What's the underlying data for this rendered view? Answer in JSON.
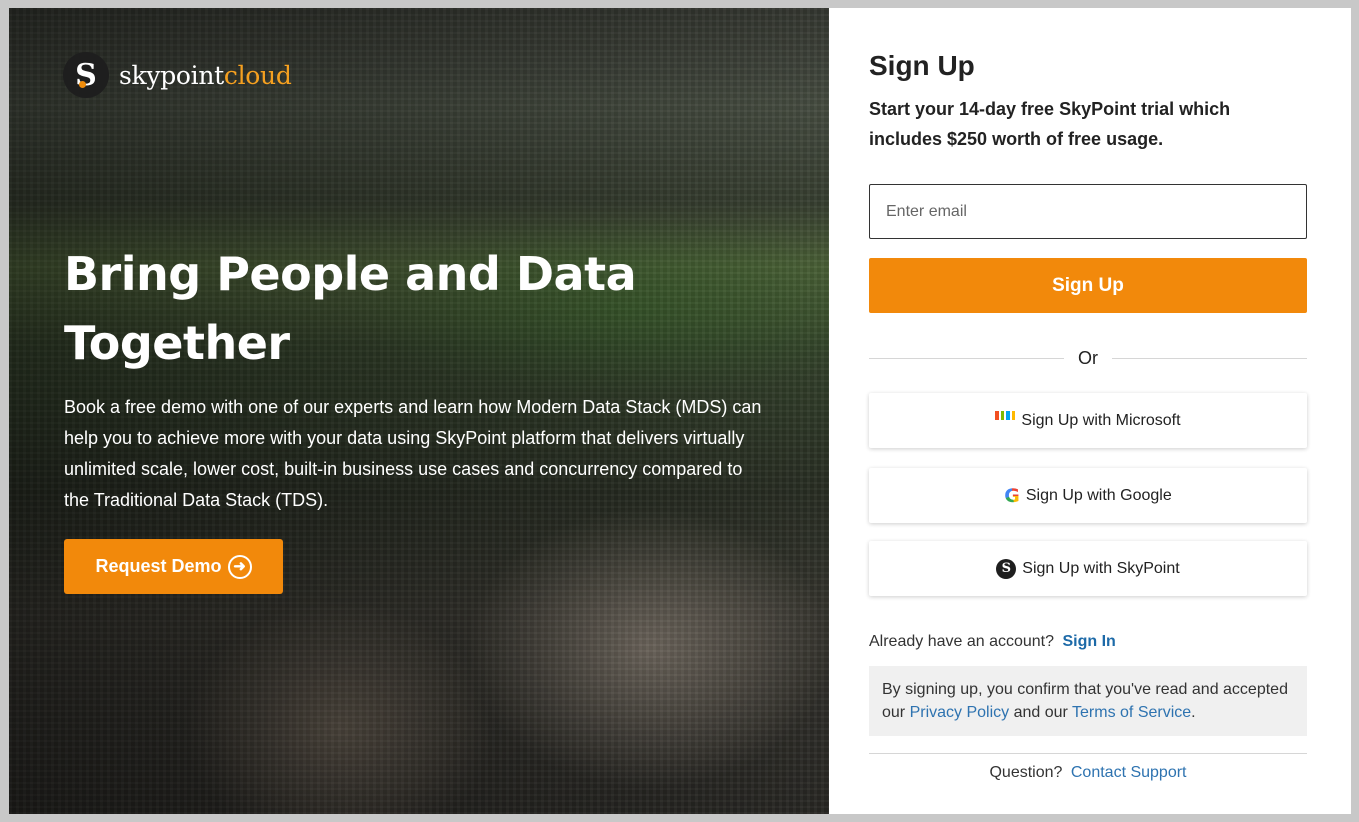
{
  "brand": {
    "logo_mark": "S",
    "name_part1": "skypoint",
    "name_part2": "cloud"
  },
  "hero": {
    "title": "Bring People and Data Together",
    "description": "Book a free demo with one of our experts and learn how Modern Data Stack (MDS) can help you to achieve more with your data using SkyPoint platform that delivers virtually unlimited scale, lower cost, built-in business use cases and concurrency compared to the Traditional Data Stack (TDS).",
    "demo_button": "Request Demo",
    "demo_icon": "arrow-right-circle-icon"
  },
  "signup": {
    "title": "Sign Up",
    "subtitle": "Start your 14-day free SkyPoint trial which includes $250 worth of free usage.",
    "email_placeholder": "Enter email",
    "email_value": "",
    "submit_label": "Sign Up",
    "divider_text": "Or",
    "sso": [
      {
        "label": "Sign Up with Microsoft",
        "icon": "microsoft-icon"
      },
      {
        "label": "Sign Up with Google",
        "icon": "google-icon"
      },
      {
        "label": "Sign Up with SkyPoint",
        "icon": "skypoint-icon"
      }
    ],
    "account_prompt": "Already have an account?",
    "signin_link": "Sign In",
    "legal_prefix": "By signing up, you confirm that you've read and accepted our",
    "privacy_link": "Privacy Policy",
    "legal_middle": "and our",
    "terms_link": "Terms of Service",
    "legal_suffix": ".",
    "question_prompt": "Question?",
    "support_link": "Contact Support"
  },
  "colors": {
    "accent": "#f2890b",
    "link": "#2e73b0",
    "microsoft": [
      "#f25022",
      "#7fba00",
      "#00a4ef",
      "#ffb900"
    ]
  }
}
